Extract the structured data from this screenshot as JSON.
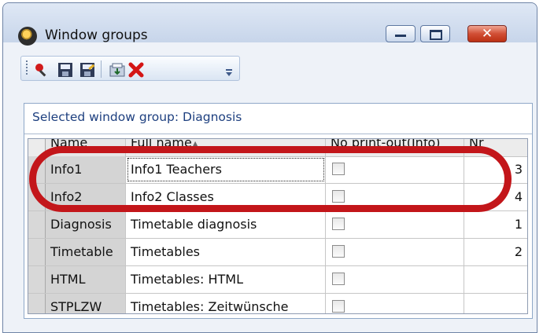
{
  "window": {
    "title": "Window groups",
    "close_glyph": "✕"
  },
  "toolbar": {
    "icons": [
      "search-icon",
      "save-icon",
      "save-as-icon",
      "import-icon",
      "delete-icon",
      "overflow-chevron-icon"
    ]
  },
  "panel": {
    "label": "Selected window group: Diagnosis"
  },
  "grid": {
    "columns": [
      "Name",
      "Full name",
      "No print-out(Info)",
      "Nr"
    ],
    "sort_indicator": "▲",
    "rows": [
      {
        "name": "Info1",
        "full": "Info1 Teachers",
        "nr": "3"
      },
      {
        "name": "Info2",
        "full": "Info2 Classes",
        "nr": "4"
      },
      {
        "name": "Diagnosis",
        "full": "Timetable diagnosis",
        "nr": "1"
      },
      {
        "name": "Timetable",
        "full": "Timetables",
        "nr": "2"
      },
      {
        "name": "HTML",
        "full": "Timetables: HTML",
        "nr": ""
      },
      {
        "name": "STPLZW",
        "full": "Timetables: Zeitwünsche",
        "nr": ""
      }
    ]
  },
  "colors": {
    "highlight": "#c3161a",
    "panel_label": "#1d3f7f",
    "title_bar": "#c7d5ea"
  }
}
